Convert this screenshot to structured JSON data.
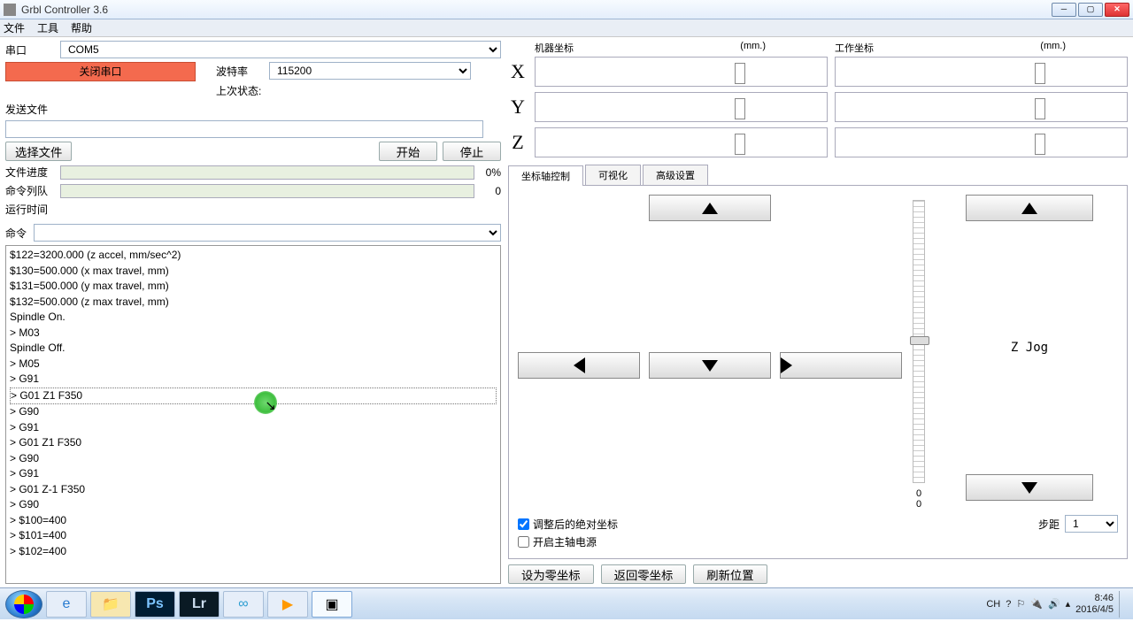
{
  "window": {
    "title": "Grbl Controller 3.6"
  },
  "menu": {
    "file": "文件",
    "tools": "工具",
    "help": "帮助"
  },
  "port": {
    "label": "串口",
    "value": "COM5",
    "close_btn": "关闭串口"
  },
  "baud": {
    "label": "波特率",
    "value": "115200"
  },
  "last_state": {
    "label": "上次状态:"
  },
  "file": {
    "send_label": "发送文件",
    "choose_btn": "选择文件",
    "start_btn": "开始",
    "stop_btn": "停止"
  },
  "progress": {
    "file_label": "文件进度",
    "file_pct": "0%",
    "queue_label": "命令列队",
    "queue_val": "0",
    "runtime_label": "运行时间"
  },
  "cmd": {
    "label": "命令"
  },
  "console_lines": [
    "$122=3200.000 (z accel, mm/sec^2)",
    "$130=500.000 (x max travel, mm)",
    "$131=500.000 (y max travel, mm)",
    "$132=500.000 (z max travel, mm)",
    "Spindle On.",
    "> M03",
    "Spindle Off.",
    "> M05",
    "> G91",
    "> G01 Z1 F350",
    "> G90",
    "> G91",
    "> G01 Z1 F350",
    "> G90",
    "> G91",
    "> G01 Z-1 F350",
    "> G90",
    "> $100=400",
    "> $101=400",
    "> $102=400"
  ],
  "coords": {
    "machine_label": "机器坐标",
    "work_label": "工作坐标",
    "unit": "(mm.)",
    "axes": [
      "X",
      "Y",
      "Z"
    ]
  },
  "tabs": {
    "axis": "坐标轴控制",
    "viz": "可视化",
    "adv": "高级设置"
  },
  "jog": {
    "z_label": "Z Jog",
    "slider_lo1": "0",
    "slider_lo2": "0",
    "step_label": "步距",
    "step_val": "1"
  },
  "checks": {
    "abs": "调整后的绝对坐标",
    "spindle": "开启主轴电源"
  },
  "zero_btns": {
    "set": "设为零坐标",
    "goto": "返回零坐标",
    "refresh": "刷新位置"
  },
  "tray": {
    "ime": "CH",
    "time": "8:46",
    "date": "2016/4/5"
  }
}
